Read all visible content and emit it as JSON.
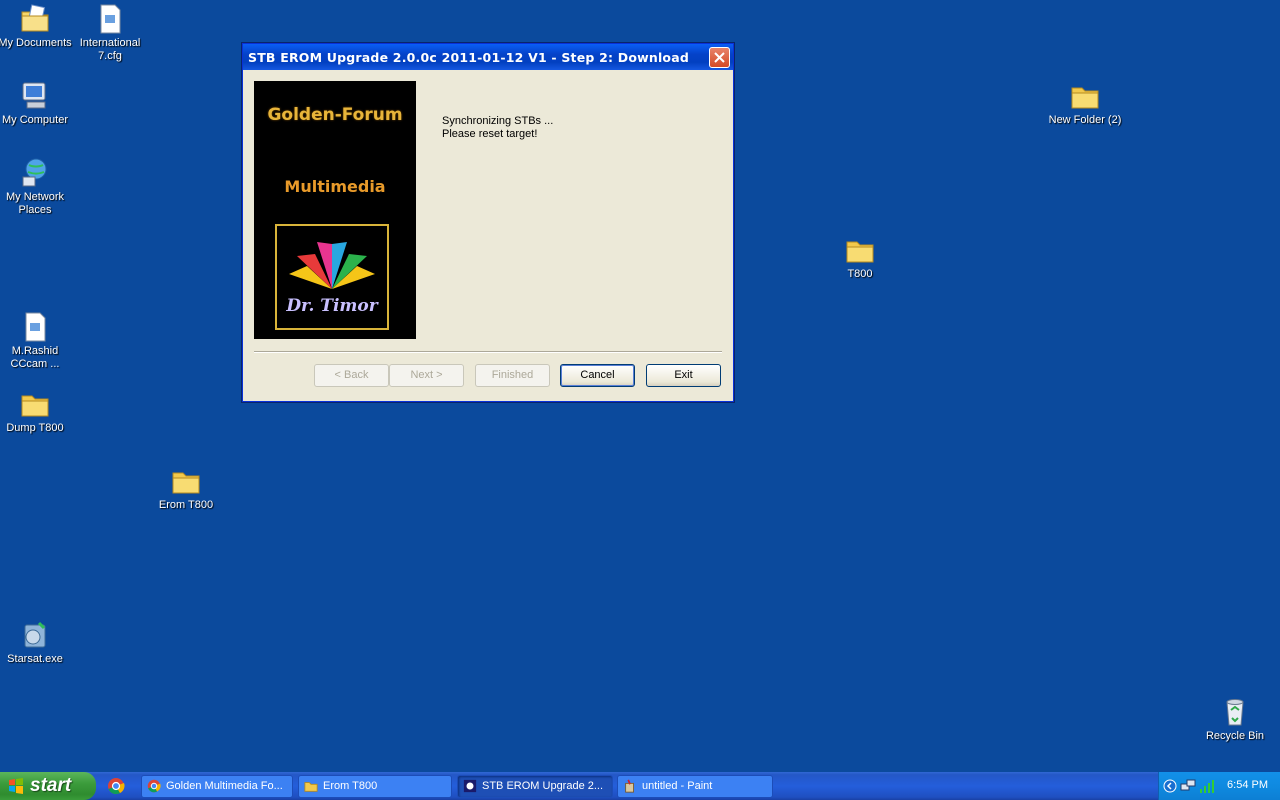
{
  "desktop": {
    "icons": [
      {
        "label": "My Documents",
        "icon": "my-documents-icon"
      },
      {
        "label": "International 7.cfg",
        "icon": "cfg-file-icon"
      },
      {
        "label": "My Computer",
        "icon": "my-computer-icon"
      },
      {
        "label": "My Network Places",
        "icon": "network-places-icon"
      },
      {
        "label": "M.Rashid CCcam ...",
        "icon": "text-file-icon"
      },
      {
        "label": "Dump T800",
        "icon": "folder-icon"
      },
      {
        "label": "Erom T800",
        "icon": "folder-icon"
      },
      {
        "label": "Starsat.exe",
        "icon": "exe-file-icon"
      },
      {
        "label": "T800",
        "icon": "folder-icon"
      },
      {
        "label": "New Folder (2)",
        "icon": "folder-icon"
      },
      {
        "label": "Recycle Bin",
        "icon": "recycle-bin-icon"
      }
    ]
  },
  "dialog": {
    "title": "STB EROM Upgrade 2.0.0c 2011-01-12 V1 - Step 2: Download",
    "banner": {
      "line1": "Golden-Forum",
      "line2": "Multimedia",
      "signature": "Dr. Timor"
    },
    "status_line1": "Synchronizing STBs ...",
    "status_line2": "Please reset target!",
    "buttons": {
      "back": "< Back",
      "next": "Next >",
      "finished": "Finished",
      "cancel": "Cancel",
      "exit": "Exit"
    }
  },
  "taskbar": {
    "start_label": "start",
    "tasks": [
      {
        "label": "Golden Multimedia Fo...",
        "icon": "chrome-icon"
      },
      {
        "label": "Erom T800",
        "icon": "folder-icon"
      },
      {
        "label": "STB EROM Upgrade 2...",
        "icon": "stb-app-icon",
        "active": true
      },
      {
        "label": "untitled - Paint",
        "icon": "paint-icon"
      }
    ],
    "clock": "6:54 PM"
  },
  "colors": {
    "desktop_bg": "#0b4a9d",
    "taskbar_blue": "#245edb",
    "start_green": "#3c9c3c",
    "dialog_bg": "#ece9d8"
  }
}
